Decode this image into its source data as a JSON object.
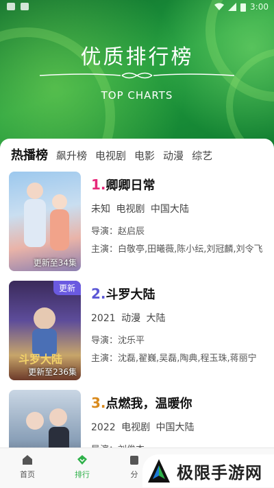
{
  "status": {
    "time": "3:00"
  },
  "hero": {
    "title": "优质排行榜",
    "subtitle": "TOP CHARTS"
  },
  "tabs": [
    {
      "label": "热播榜",
      "active": true
    },
    {
      "label": "飙升榜",
      "active": false
    },
    {
      "label": "电视剧",
      "active": false
    },
    {
      "label": "电影",
      "active": false
    },
    {
      "label": "动漫",
      "active": false
    },
    {
      "label": "综艺",
      "active": false
    }
  ],
  "items": [
    {
      "rank": "1.",
      "rank_color": "#e6287a",
      "title": "卿卿日常",
      "meta": "未知 电视剧 中国大陆",
      "director": "导演：赵启辰",
      "cast": "主演：白敬亭,田曦薇,陈小纭,刘冠麟,刘令飞",
      "poster_caption": "更新至34集",
      "badge": ""
    },
    {
      "rank": "2.",
      "rank_color": "#5b57d6",
      "title": "斗罗大陆",
      "meta": "2021 动漫 大陆",
      "director": "导演：沈乐平",
      "cast": "主演：沈磊,翟巍,吴磊,陶典,程玉珠,蒋丽宁",
      "poster_caption": "更新至236集",
      "badge": "更新"
    },
    {
      "rank": "3.",
      "rank_color": "#d98a1c",
      "title": "点燃我，温暖你",
      "meta": "2022 电视剧 中国大陆",
      "director": "导演：刘俊杰",
      "cast": "",
      "poster_caption": "",
      "badge": ""
    }
  ],
  "nav": [
    {
      "label": "首页",
      "icon": "home-icon",
      "active": false
    },
    {
      "label": "排行",
      "icon": "ranking-icon",
      "active": true
    },
    {
      "label": "分",
      "icon": "category-icon",
      "active": false
    }
  ],
  "watermark": {
    "text": "极限手游网"
  },
  "colors": {
    "accent": "#2fb14a",
    "hero_green": "#1f9a3d"
  }
}
